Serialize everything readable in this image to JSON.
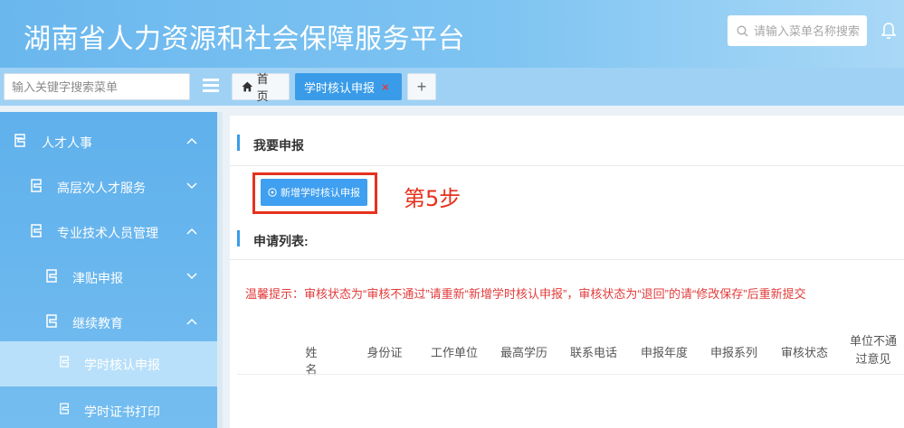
{
  "header": {
    "title": "湖南省人力资源和社会保障服务平台",
    "search_placeholder": "请输入菜单名称搜索"
  },
  "tabbar": {
    "menu_search_placeholder": "输入关键字搜索菜单",
    "tabs": [
      {
        "label": "首页",
        "icon": "home-icon"
      },
      {
        "label": "学时核认申报",
        "close": "×",
        "active": true
      },
      {
        "label": "+"
      }
    ]
  },
  "sidebar": {
    "items": [
      {
        "label": "人才人事",
        "level": 1,
        "arrow": "up"
      },
      {
        "label": "高层次人才服务",
        "level": 2,
        "arrow": "down"
      },
      {
        "label": "专业技术人员管理",
        "level": 2,
        "arrow": "up"
      },
      {
        "label": "津贴申报",
        "level": 3,
        "arrow": "down"
      },
      {
        "label": "继续教育",
        "level": 3,
        "arrow": "up"
      },
      {
        "label": "学时核认申报",
        "level": 4,
        "active": true
      },
      {
        "label": "学时证书打印",
        "level": 4
      }
    ]
  },
  "main": {
    "apply_title": "我要申报",
    "add_button": "新增学时核认申报",
    "step_annotation": "第5步",
    "list_title": "申请列表:",
    "tip": "温馨提示：审核状态为“审核不通过”请重新“新增学时核认申报”，审核状态为“退回”的请“修改保存”后重新提交",
    "columns": [
      "姓名",
      "身份证",
      "工作单位",
      "最高学历",
      "联系电话",
      "申报年度",
      "申报系列",
      "审核状态",
      "单位不通过意见"
    ]
  },
  "colors": {
    "header_gradient_start": "#6ab7ee",
    "accent": "#3a9ce8",
    "annotation_red": "#e5321d",
    "tip_red": "#e23b3b"
  }
}
